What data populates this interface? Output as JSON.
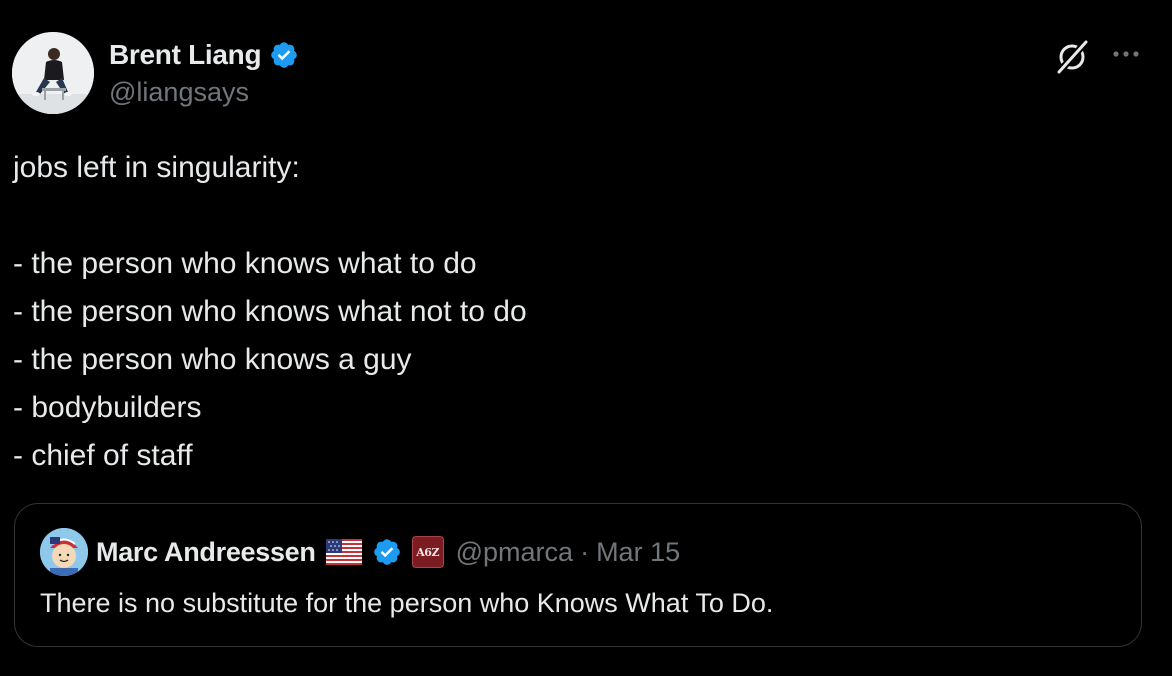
{
  "author": {
    "name": "Brent Liang",
    "handle": "@liangsays",
    "verified": true
  },
  "tweet": {
    "lines": [
      "jobs left in singularity:",
      "",
      "- the person who knows what to do",
      "- the person who knows what not to do",
      "- the person who knows a guy",
      "- bodybuilders",
      "- chief of staff"
    ]
  },
  "quote": {
    "name": "Marc Andreessen",
    "handle": "@pmarca",
    "separator": "·",
    "date": "Mar 15",
    "affiliate_label": "A6Z",
    "text": "There is no substitute for the person who Knows What To Do."
  },
  "icons": {
    "grok": "grok-icon",
    "more": "more-icon",
    "verified": "verified-badge-icon",
    "flag": "us-flag-icon"
  },
  "colors": {
    "background": "#000000",
    "text": "#e7e9ea",
    "secondary": "#71767b",
    "verified_blue": "#1d9bf0",
    "border": "#2f3336"
  }
}
